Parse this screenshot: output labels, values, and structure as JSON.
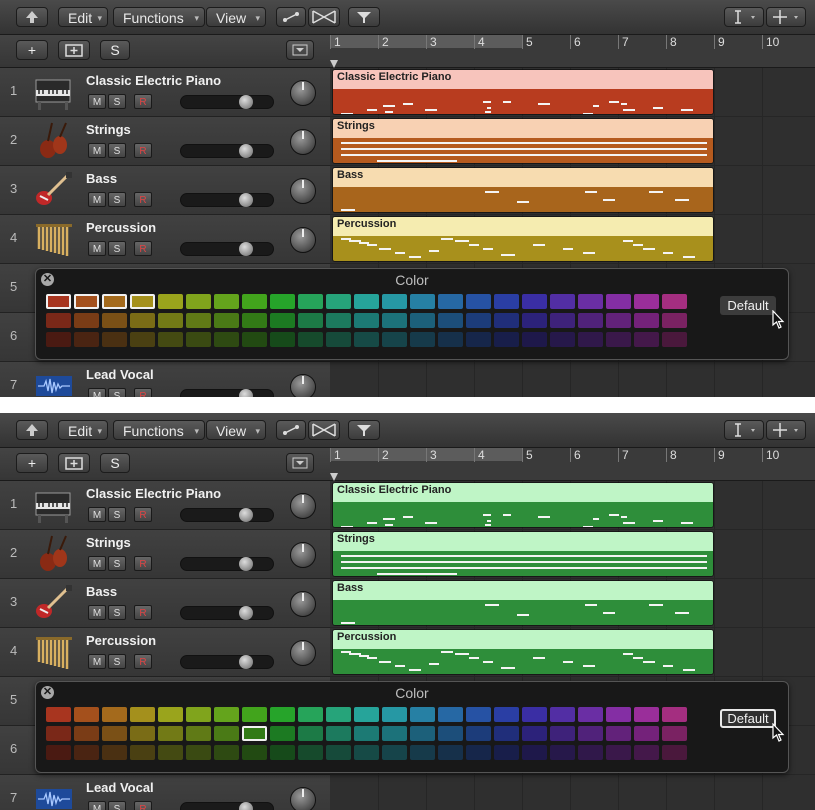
{
  "toolbar": {
    "edit": "Edit",
    "functions": "Functions",
    "view": "View"
  },
  "header": {
    "add": "+",
    "solo": "S"
  },
  "ruler": [
    "1",
    "2",
    "3",
    "4",
    "5",
    "6",
    "7",
    "8",
    "9",
    "10"
  ],
  "tracks": [
    {
      "num": "1",
      "name": "Classic Electric Piano",
      "icon": "piano-icon"
    },
    {
      "num": "2",
      "name": "Strings",
      "icon": "violin-icon"
    },
    {
      "num": "3",
      "name": "Bass",
      "icon": "bass-guitar-icon"
    },
    {
      "num": "4",
      "name": "Percussion",
      "icon": "chimes-icon"
    },
    {
      "num": "5",
      "name": ""
    },
    {
      "num": "6",
      "name": ""
    },
    {
      "num": "7",
      "name": "Lead Vocal",
      "icon": "audio-waveform-icon"
    }
  ],
  "track_buttons": {
    "mute": "M",
    "solo": "S",
    "record": "R"
  },
  "panels": [
    {
      "regions": [
        {
          "name": "Classic Electric Piano",
          "header_color": "#f7c4bc",
          "body_color": "#b83c1f"
        },
        {
          "name": "Strings",
          "header_color": "#f8d1b3",
          "body_color": "#b55a1e"
        },
        {
          "name": "Bass",
          "header_color": "#f7dcb0",
          "body_color": "#a8651c"
        },
        {
          "name": "Percussion",
          "header_color": "#f5ecb0",
          "body_color": "#a8901c"
        }
      ],
      "selected_swatches": [
        "0-0",
        "0-1",
        "0-2",
        "0-3"
      ],
      "default_highlighted": false
    },
    {
      "regions": [
        {
          "name": "Classic Electric Piano",
          "header_color": "#bff5c6",
          "body_color": "#2e8e3a"
        },
        {
          "name": "Strings",
          "header_color": "#bff5c6",
          "body_color": "#2e8e3a"
        },
        {
          "name": "Bass",
          "header_color": "#bff5c6",
          "body_color": "#2e8e3a"
        },
        {
          "name": "Percussion",
          "header_color": "#bff5c6",
          "body_color": "#2e8e3a"
        }
      ],
      "selected_swatches": [
        "1-7"
      ],
      "default_highlighted": true
    }
  ],
  "color_panel": {
    "title": "Color",
    "default_label": "Default",
    "rows": [
      [
        "#a8351f",
        "#a4501c",
        "#a46a1c",
        "#a4901c",
        "#9aa41c",
        "#80a41c",
        "#64a41c",
        "#42a41c",
        "#26a42a",
        "#26a45a",
        "#26a47a",
        "#26a49a",
        "#2698a4",
        "#2680a4",
        "#2668a4",
        "#2652a4",
        "#2a3ea4",
        "#3a2ea4",
        "#522ea4",
        "#6a2ea4",
        "#842ea4",
        "#9a2e9a",
        "#a42e80"
      ],
      [
        "#7a2818",
        "#7a3c16",
        "#7a5016",
        "#7a6c16",
        "#727a16",
        "#607a16",
        "#4a7a16",
        "#327a16",
        "#1c7a22",
        "#1c7a46",
        "#1c7a5e",
        "#1c7a74",
        "#1c727a",
        "#1c607a",
        "#1c4e7a",
        "#1c3c7a",
        "#202e7a",
        "#2c227a",
        "#3e227a",
        "#50227a",
        "#62227a",
        "#74227a",
        "#7a2262"
      ],
      [
        "#4a1a12",
        "#4a2412",
        "#4a3012",
        "#4a4012",
        "#444a12",
        "#3a4a12",
        "#2e4a12",
        "#224a12",
        "#164a1a",
        "#164a2c",
        "#164a3a",
        "#164a46",
        "#16444a",
        "#163a4a",
        "#16304a",
        "#16264a",
        "#181e4a",
        "#1e184a",
        "#26184a",
        "#30184a",
        "#3a184a",
        "#44184a",
        "#4a183c"
      ]
    ]
  }
}
